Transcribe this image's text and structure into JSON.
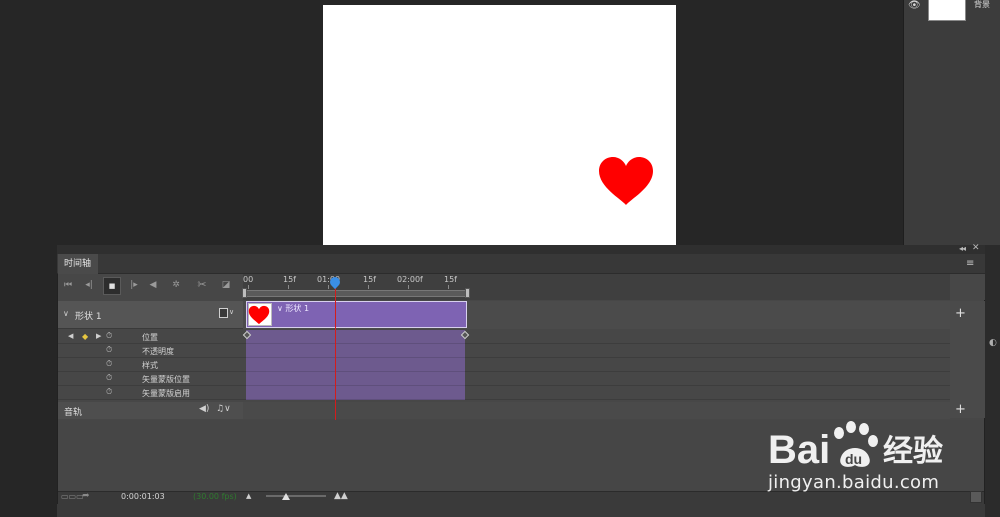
{
  "layers_panel": {
    "layer_name": "背景",
    "eye_icon": "eye-icon"
  },
  "timeline": {
    "tab_title": "时间轴",
    "ruler_labels": [
      "00",
      "15f",
      "01:00",
      "15f",
      "02:00f",
      "15f"
    ],
    "layer": {
      "name": "形状 1",
      "clip_label": "形状 1"
    },
    "properties": [
      "位置",
      "不透明度",
      "样式",
      "矢量蒙版位置",
      "矢量蒙版启用"
    ],
    "audio_track_label": "音轨",
    "timecode": "0:00:01:03",
    "fps": "(30.00 fps)"
  },
  "colors": {
    "clip": "#7e63b3",
    "clip_property_fill": "#6d5a8e",
    "playhead_line": "#d41c1c",
    "playhead_marker": "#3a8ee6",
    "heart": "#ff0000",
    "keyframe_nav_active": "#e6c640"
  },
  "watermark": {
    "logo_text": "Bai 经验",
    "domain": "jingyan.baidu.com"
  }
}
